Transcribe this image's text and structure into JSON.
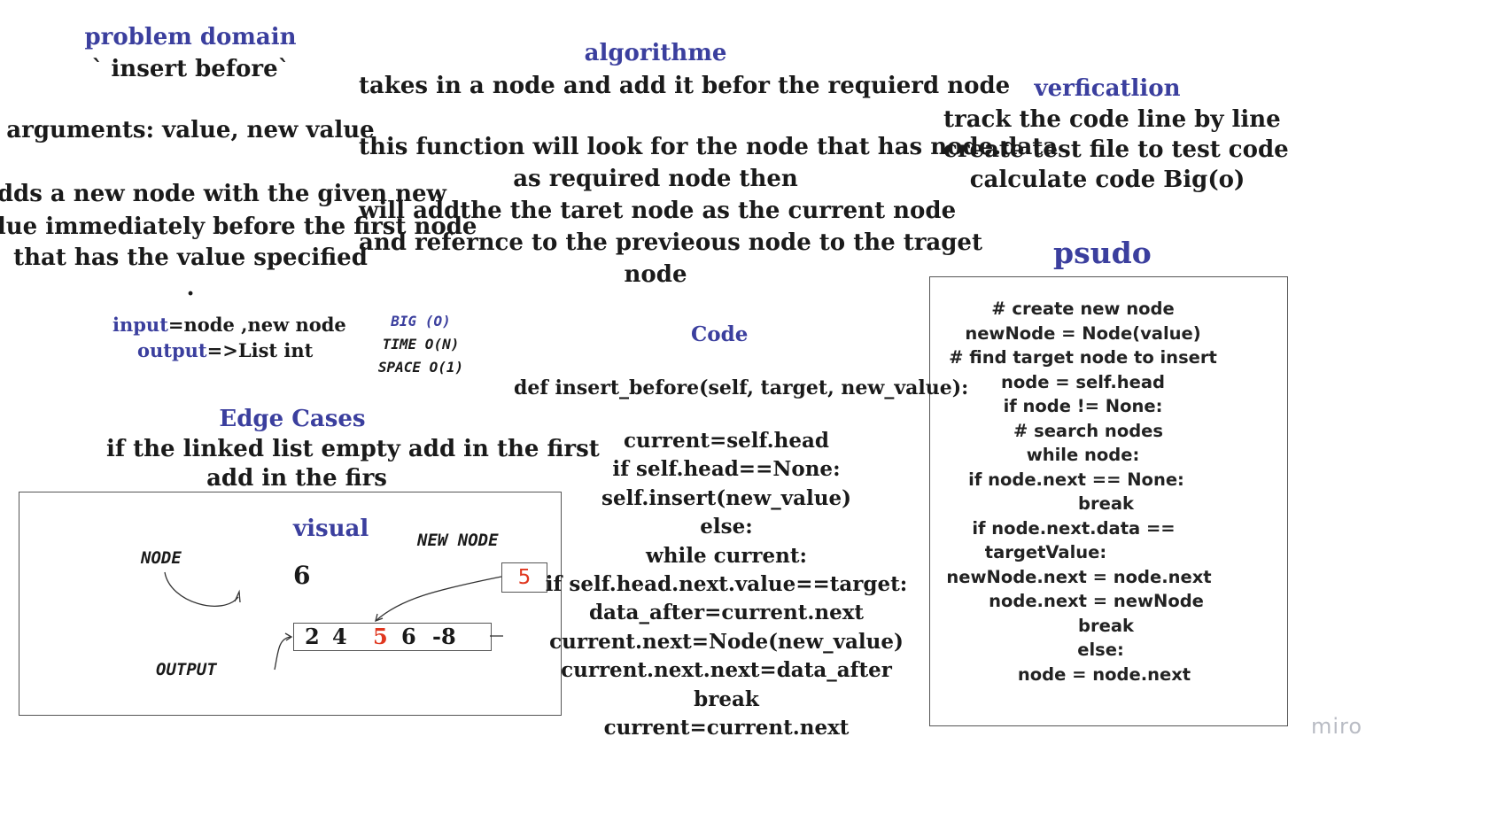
{
  "problem_domain": {
    "title": "problem domain",
    "name": "` insert before`",
    "arguments": "arguments: value, new value",
    "description": [
      "adds a new node with the given new",
      "alue immediately before the first node",
      "that has the value specified",
      "."
    ]
  },
  "io": {
    "input_label": "input",
    "input_value": "=node ,new node",
    "output_label": "output",
    "output_value": "=>List int"
  },
  "big_o": {
    "title": "BIG (O)",
    "time": "TIME O(N)",
    "space": "SPACE O(1)"
  },
  "algorithm": {
    "title": "algorithme",
    "lines": [
      "takes in a node and add it befor the requierd node",
      "",
      "this function will look for the node that has node.data",
      "as required node then",
      "will addthe the taret node  as the current node",
      "and refernce to the previeous node to the traget",
      "node"
    ]
  },
  "verification": {
    "title": "verficatlion",
    "lines": [
      "track the code line by line",
      "create test file to test code",
      "calculate code Big(o)"
    ]
  },
  "psudo": {
    "title": "psudo",
    "lines": [
      "# create new node",
      "newNode = Node(value)",
      "# find target node to insert",
      "node = self.head",
      "if node != None:",
      "# search nodes",
      "while node:",
      "if node.next == None:",
      "break",
      "if node.next.data ==",
      "targetValue:",
      "newNode.next = node.next",
      "node.next = newNode",
      "break",
      "else:",
      "node = node.next"
    ]
  },
  "edge_cases": {
    "title": "Edge Cases",
    "lines": [
      "if the linked list empty add in the first",
      "add in the firs"
    ]
  },
  "visual": {
    "title": "visual",
    "node_label": "NODE",
    "new_node_label": "NEW NODE",
    "output_label": "OUTPUT",
    "node_value": "6",
    "new_node_value": "5",
    "list_values": [
      "2",
      "4",
      "5",
      "6",
      "-8"
    ],
    "highlight_color": "#e0371f"
  },
  "code": {
    "title": "Code",
    "signature": "def insert_before(self, target, new_value):",
    "lines": [
      "current=self.head",
      "if self.head==None:",
      "self.insert(new_value)",
      "else:",
      "while current:",
      "if self.head.next.value==target:",
      "data_after=current.next",
      "current.next=Node(new_value)",
      "current.next.next=data_after",
      "break",
      "current=current.next"
    ]
  },
  "branding": {
    "logo": "miro"
  },
  "colors": {
    "heading": "#3b3f9e",
    "text": "#1a1a1a",
    "accent": "#e0371f"
  }
}
